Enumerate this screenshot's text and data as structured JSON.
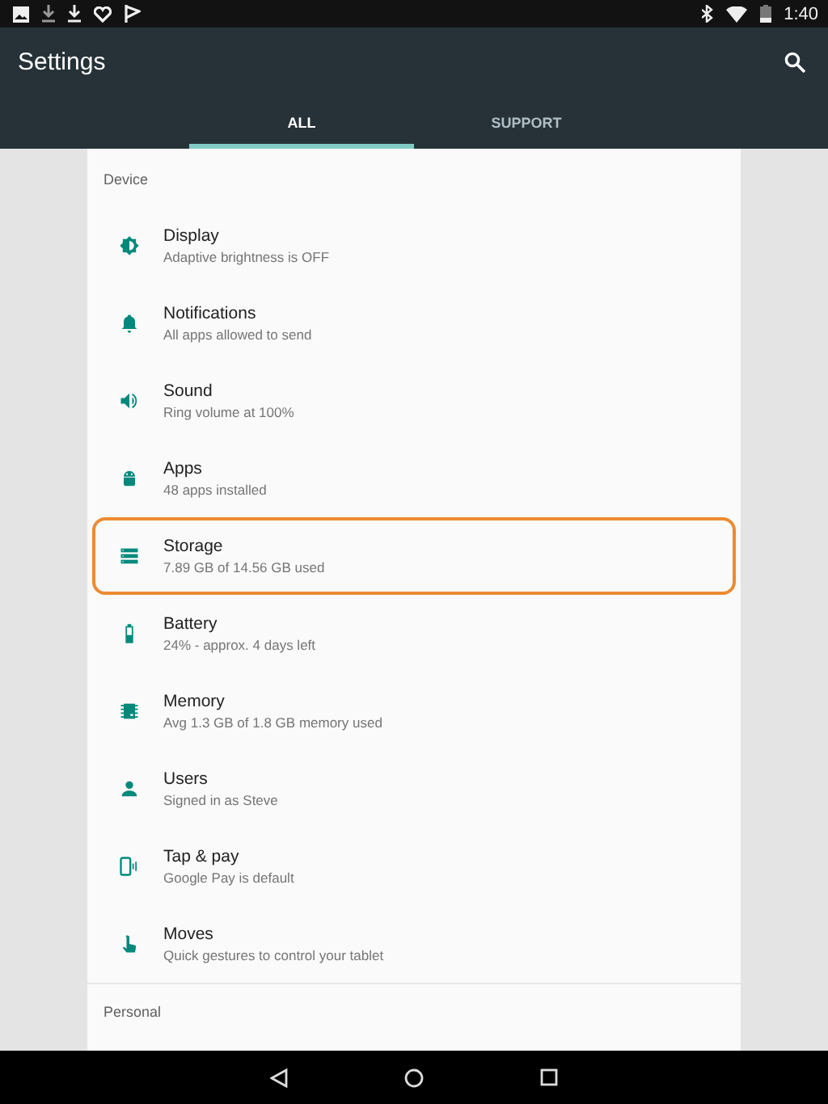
{
  "status_bar": {
    "time": "1:40"
  },
  "app_bar": {
    "title": "Settings"
  },
  "tabs": [
    {
      "label": "ALL",
      "selected": true
    },
    {
      "label": "SUPPORT",
      "selected": false
    }
  ],
  "sections": [
    {
      "header": "Device",
      "items": [
        {
          "title": "Display",
          "subtitle": "Adaptive brightness is OFF",
          "selected": false
        },
        {
          "title": "Notifications",
          "subtitle": "All apps allowed to send",
          "selected": false
        },
        {
          "title": "Sound",
          "subtitle": "Ring volume at 100%",
          "selected": false
        },
        {
          "title": "Apps",
          "subtitle": "48 apps installed",
          "selected": false
        },
        {
          "title": "Storage",
          "subtitle": "7.89 GB of 14.56 GB used",
          "selected": true
        },
        {
          "title": "Battery",
          "subtitle": "24% - approx. 4 days left",
          "selected": false
        },
        {
          "title": "Memory",
          "subtitle": "Avg 1.3 GB of 1.8 GB memory used",
          "selected": false
        },
        {
          "title": "Users",
          "subtitle": "Signed in as Steve",
          "selected": false
        },
        {
          "title": "Tap & pay",
          "subtitle": "Google Pay is default",
          "selected": false
        },
        {
          "title": "Moves",
          "subtitle": "Quick gestures to control your tablet",
          "selected": false
        }
      ]
    },
    {
      "header": "Personal"
    }
  ]
}
